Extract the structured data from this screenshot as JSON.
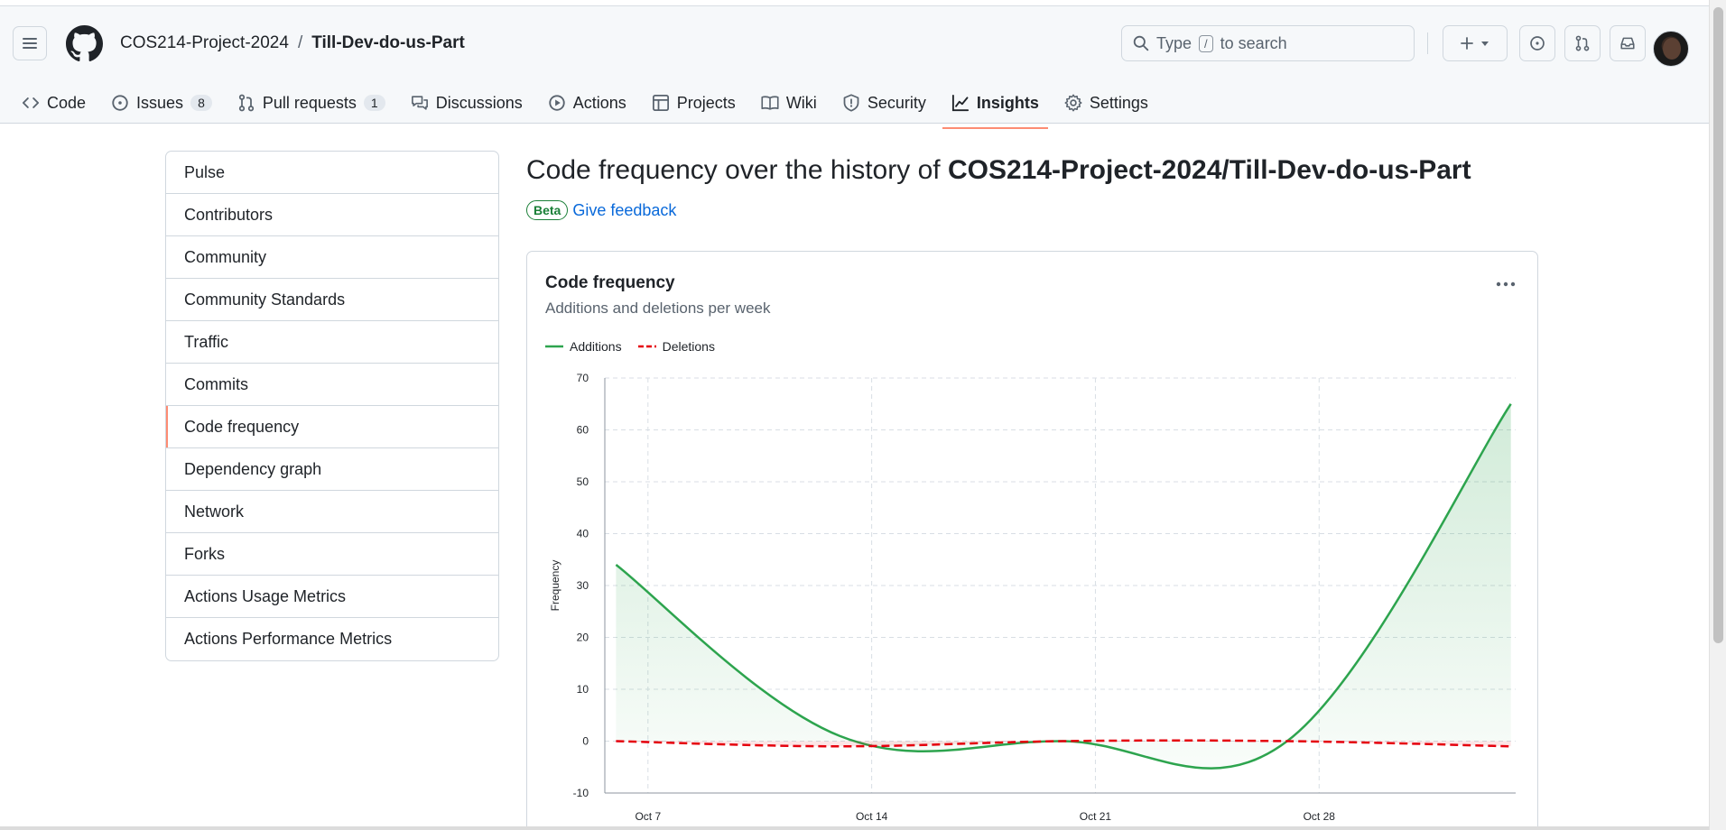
{
  "header": {
    "owner": "COS214-Project-2024",
    "separator": "/",
    "repo": "Till-Dev-do-us-Part",
    "search_prefix": "Type",
    "search_key": "/",
    "search_suffix": "to search"
  },
  "tabs": [
    {
      "label": "Code",
      "icon": "code-icon"
    },
    {
      "label": "Issues",
      "icon": "issue-icon",
      "count": "8"
    },
    {
      "label": "Pull requests",
      "icon": "pull-request-icon",
      "count": "1"
    },
    {
      "label": "Discussions",
      "icon": "discussions-icon"
    },
    {
      "label": "Actions",
      "icon": "play-icon"
    },
    {
      "label": "Projects",
      "icon": "table-icon"
    },
    {
      "label": "Wiki",
      "icon": "book-icon"
    },
    {
      "label": "Security",
      "icon": "shield-icon"
    },
    {
      "label": "Insights",
      "icon": "graph-icon",
      "active": true
    },
    {
      "label": "Settings",
      "icon": "gear-icon"
    }
  ],
  "sidebar": {
    "items": [
      {
        "label": "Pulse"
      },
      {
        "label": "Contributors"
      },
      {
        "label": "Community"
      },
      {
        "label": "Community Standards"
      },
      {
        "label": "Traffic"
      },
      {
        "label": "Commits"
      },
      {
        "label": "Code frequency",
        "selected": true
      },
      {
        "label": "Dependency graph"
      },
      {
        "label": "Network"
      },
      {
        "label": "Forks"
      },
      {
        "label": "Actions Usage Metrics"
      },
      {
        "label": "Actions Performance Metrics"
      }
    ]
  },
  "main": {
    "title_prefix": "Code frequency over the history of",
    "title_repo": "COS214-Project-2024/Till-Dev-do-us-Part",
    "beta": "Beta",
    "feedback": "Give feedback"
  },
  "card": {
    "title": "Code frequency",
    "subtitle": "Additions and deletions per week"
  },
  "colors": {
    "additions": "#2da44e",
    "deletions": "#e5000d",
    "accent_tab": "#fd8c73",
    "link": "#0969da"
  },
  "chart_data": {
    "type": "area",
    "title": "Code frequency",
    "subtitle": "Additions and deletions per week",
    "xlabel": "",
    "ylabel": "Frequency",
    "ylim": [
      -10,
      70
    ],
    "yticks": [
      -10,
      0,
      10,
      20,
      30,
      40,
      50,
      60,
      70
    ],
    "xticks": [
      "Oct 7",
      "Oct 14",
      "Oct 21",
      "Oct 28"
    ],
    "legend_position": "top-left",
    "grid": true,
    "series": [
      {
        "name": "Additions",
        "style": "solid",
        "color": "#2da44e",
        "x": [
          "2024-10-06",
          "2024-10-13",
          "2024-10-20",
          "2024-10-27",
          "2024-11-03"
        ],
        "values": [
          34,
          1,
          0,
          0,
          65
        ]
      },
      {
        "name": "Deletions",
        "style": "dashed",
        "color": "#e5000d",
        "x": [
          "2024-10-06",
          "2024-10-13",
          "2024-10-20",
          "2024-10-27",
          "2024-11-03"
        ],
        "values": [
          0,
          -1,
          0,
          0,
          -1
        ]
      }
    ]
  }
}
